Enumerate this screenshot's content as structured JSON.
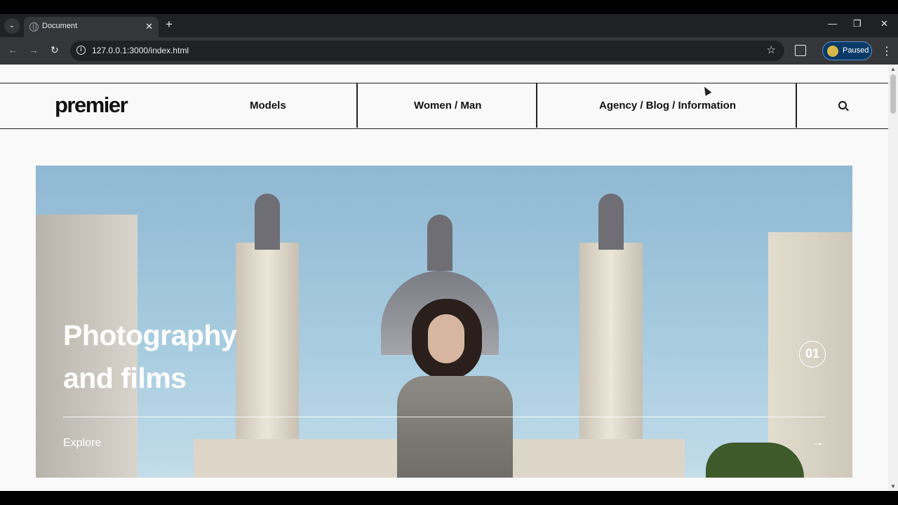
{
  "browser": {
    "tab_title": "Document",
    "tab_close": "✕",
    "new_tab": "+",
    "url": "127.0.0.1:3000/index.html",
    "profile_status": "Paused",
    "controls": {
      "minimize": "—",
      "restore": "❐",
      "close": "✕"
    },
    "nav": {
      "back": "←",
      "forward": "→",
      "reload": "↻"
    },
    "tab_list": "⌄",
    "bookmark": "☆",
    "menu": "⋮",
    "info": "i"
  },
  "site": {
    "logo": "premier",
    "nav": [
      "Models",
      "Women / Man",
      "Agency / Blog / Information"
    ]
  },
  "hero": {
    "title_line1": "Photography",
    "title_line2": "and films",
    "slide_number": "01",
    "cta": "Explore",
    "arrow": "→"
  }
}
